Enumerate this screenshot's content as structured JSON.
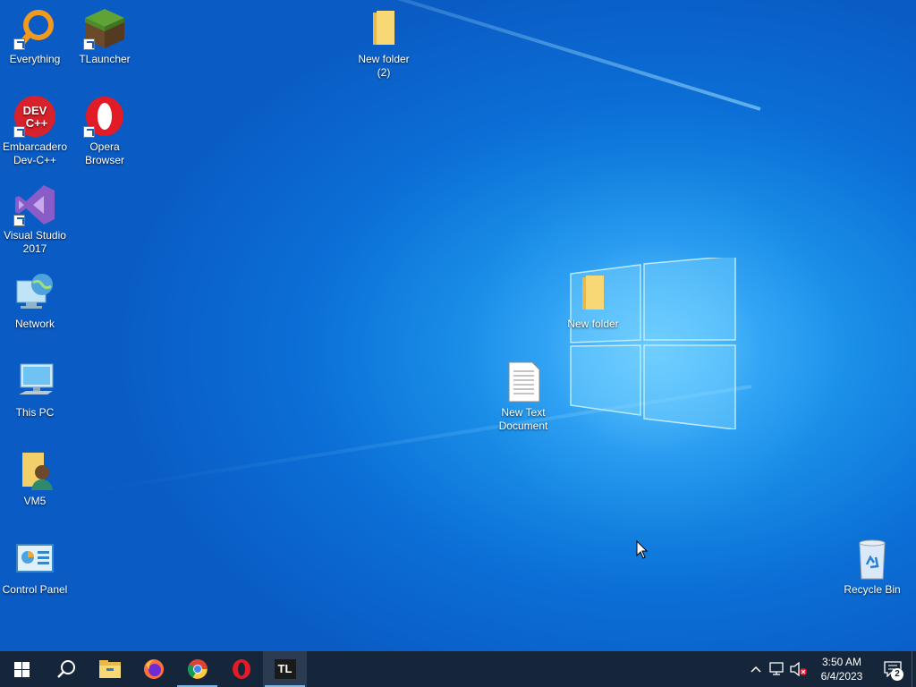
{
  "desktop": {
    "icons": [
      {
        "label": "Everything"
      },
      {
        "label": "TLauncher"
      },
      {
        "label": "New folder\n(2)"
      },
      {
        "label": "Embarcadero\nDev-C++"
      },
      {
        "label": "Opera\nBrowser"
      },
      {
        "label": "Visual Studio\n2017"
      },
      {
        "label": "Network"
      },
      {
        "label": "New folder"
      },
      {
        "label": "This PC"
      },
      {
        "label": "New Text\nDocument"
      },
      {
        "label": "VM5"
      },
      {
        "label": "Control Panel"
      },
      {
        "label": "Recycle Bin"
      }
    ],
    "devcpp_badge_line1": "DEV",
    "devcpp_badge_line2": "C++"
  },
  "taskbar": {
    "apps": [
      {
        "name": "start-icon"
      },
      {
        "name": "search-icon"
      },
      {
        "name": "file-explorer-icon"
      },
      {
        "name": "firefox-icon"
      },
      {
        "name": "chrome-icon"
      },
      {
        "name": "opera-icon"
      },
      {
        "name": "tlauncher-icon",
        "text": "TL"
      }
    ],
    "clock": {
      "time": "3:50 AM",
      "date": "6/4/2023"
    },
    "notification_count": "2"
  },
  "colors": {
    "taskbar": "#15263a",
    "accent": "#1a8fe8"
  }
}
